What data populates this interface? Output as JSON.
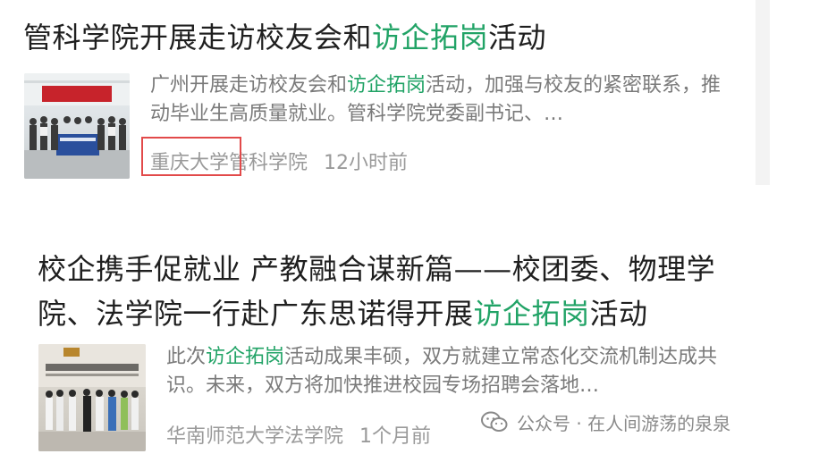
{
  "results": [
    {
      "title_before": "管科学院开展走访校友会和",
      "title_highlight": "访企拓岗",
      "title_after": "活动",
      "summary_before": "广州开展走访校友会和",
      "summary_highlight": "访企拓岗",
      "summary_after": "活动，加强与校友的紧密联系，推动毕业生高质量就业。管科学院党委副书记、…",
      "source_a": "重庆大学",
      "source_b": "管科学院",
      "time": "12小时前"
    },
    {
      "title_before": "校企携手促就业 产教融合谋新篇——校团委、物理学院、法学院一行赴广东思诺得开展",
      "title_highlight": "访企拓岗",
      "title_after": "活动",
      "summary_before": "此次",
      "summary_highlight": "访企拓岗",
      "summary_after": "活动成果丰硕，双方就建立常态化交流机制达成共识。未来，双方将加快推进校园专场招聘会落地…",
      "source": "华南师范大学法学院",
      "time": "1个月前"
    }
  ],
  "watermark": {
    "icon": "wechat-icon",
    "text": "公众号 · 在人间游荡的泉泉"
  },
  "colors": {
    "highlight": "#21a366",
    "annotation_box": "#e24a4a"
  }
}
